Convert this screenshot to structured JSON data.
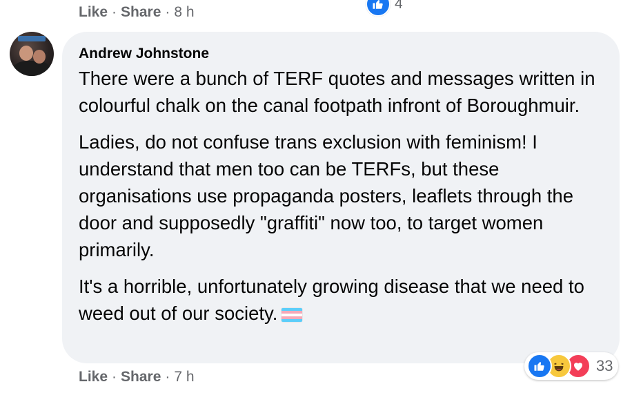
{
  "previous_comment": {
    "like_label": "Like",
    "share_label": "Share",
    "separator": "·",
    "time": "8 h",
    "reaction_count": "4",
    "reaction_icons": [
      "like-icon"
    ]
  },
  "comment": {
    "author": "Andrew Johnstone",
    "paragraphs": [
      "There were a bunch of TERF quotes and messages written in colourful chalk on the canal footpath infront of Boroughmuir.",
      "Ladies, do not confuse trans exclusion with feminism! I understand that men too can be TERFs, but these organisations use propaganda posters, leaflets through the door and supposedly \"graffiti\" now too, to target women primarily.",
      "It's a horrible, unfortunately growing disease that we need to weed out of our society."
    ],
    "emoji": "transgender-flag",
    "like_label": "Like",
    "share_label": "Share",
    "separator": "·",
    "time": "7 h",
    "reaction_count": "33",
    "reaction_icons": [
      "like-icon",
      "haha-icon",
      "love-icon"
    ]
  },
  "colors": {
    "bubble": "#f0f2f5",
    "meta_text": "#65676b",
    "like_blue": "#1877f2",
    "love_red": "#f33e58",
    "haha_yellow": "#f7c83d"
  }
}
